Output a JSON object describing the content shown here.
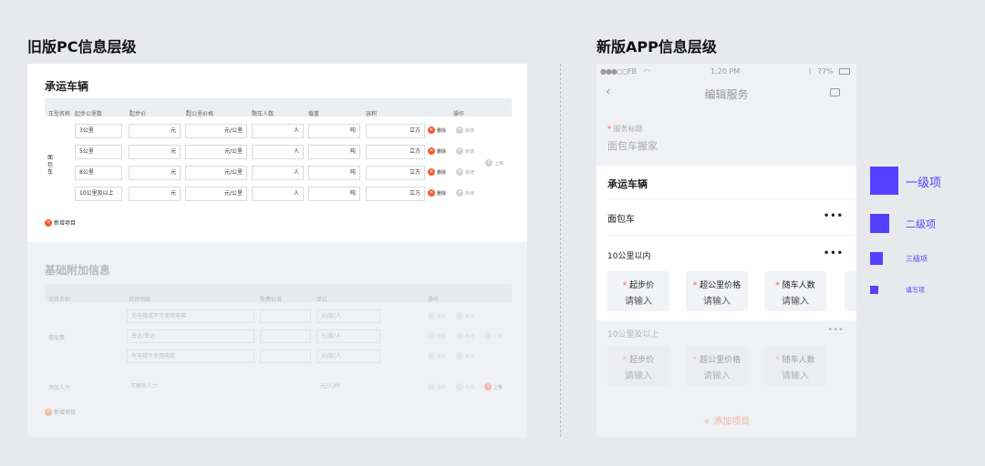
{
  "headings": {
    "old": "旧版PC信息层级",
    "new": "新版APP信息层级"
  },
  "pc": {
    "section1_title": "承运车辆",
    "columns": [
      {
        "star": false,
        "label": "车型名称"
      },
      {
        "star": false,
        "label": "起步公里数"
      },
      {
        "star": true,
        "label": "起步价"
      },
      {
        "star": true,
        "label": "超公里价格"
      },
      {
        "star": true,
        "label": "随车人数"
      },
      {
        "star": false,
        "label": "载重"
      },
      {
        "star": false,
        "label": "容积"
      },
      {
        "star": false,
        "label": "操作"
      }
    ],
    "vehicle_name": "面包车",
    "rows": [
      {
        "km": "3公里",
        "start": "元",
        "over": "元/公里",
        "people": "人",
        "weight": "吨",
        "volume": "立方"
      },
      {
        "km": "5公里",
        "start": "元",
        "over": "元/公里",
        "people": "人",
        "weight": "吨",
        "volume": "立方"
      },
      {
        "km": "8公里",
        "start": "元",
        "over": "元/公里",
        "people": "人",
        "weight": "吨",
        "volume": "立方"
      },
      {
        "km": "10公里及以上",
        "start": "元",
        "over": "元/公里",
        "people": "人",
        "weight": "吨",
        "volume": "立方"
      }
    ],
    "delete_label": "删除",
    "add_label": "新增",
    "move_up_label": "上移",
    "add_item_label": "新增项目",
    "section2_title": "基础附加信息",
    "columns2": [
      {
        "star": false,
        "label": "项目名称"
      },
      {
        "star": false,
        "label": "项目明细"
      },
      {
        "star": true,
        "label": "收费标准"
      },
      {
        "star": false,
        "label": "单位"
      },
      {
        "star": false,
        "label": "操作"
      }
    ],
    "group_a": "楼层费",
    "rows2": [
      {
        "detail": "无电梯或不可使用电梯",
        "unit": "元/层/人"
      },
      {
        "detail": "普达/货达",
        "unit": "元/层/人"
      },
      {
        "detail": "有电梯可使用电梯",
        "unit": "元/层/人"
      }
    ],
    "group_b": "添加人力",
    "row_b_detail": "可额外人力",
    "row_b_unit": "元/人/时"
  },
  "phone": {
    "carrier": "FB",
    "time": "1:20 PM",
    "battery": "77%",
    "nav_title": "编辑服务",
    "service_label": "服务标题",
    "service_value": "面包车搬家",
    "card_title": "承运车辆",
    "level2": "面包车",
    "level3": "10公里以内",
    "more": "•••",
    "fields": [
      {
        "label": "起步价",
        "placeholder": "请输入"
      },
      {
        "label": "超公里价格",
        "placeholder": "请输入"
      },
      {
        "label": "随车人数",
        "placeholder": "请输入"
      }
    ],
    "level3b": "10公里及以上",
    "add_item": "+ 添加项目"
  },
  "legend": [
    {
      "label": "一级项"
    },
    {
      "label": "二级项"
    },
    {
      "label": "三级项"
    },
    {
      "label": "填写项"
    }
  ],
  "accent": "#5540ff",
  "danger": "#f25a2c"
}
